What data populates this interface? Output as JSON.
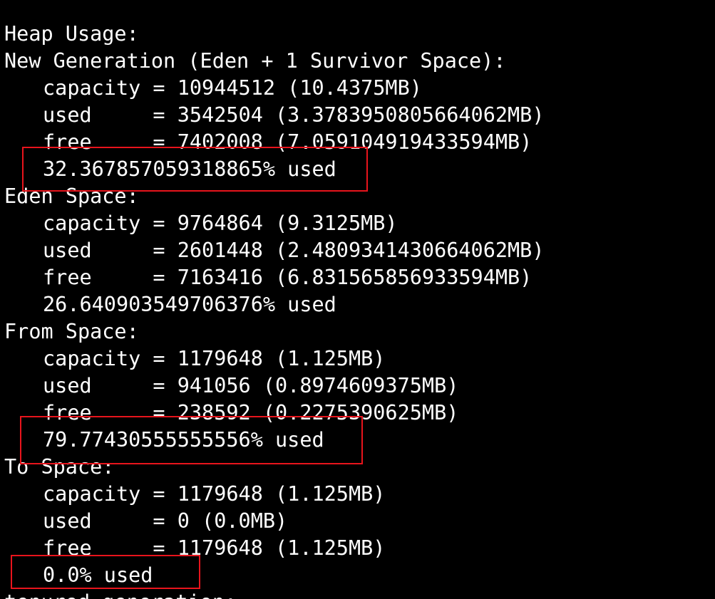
{
  "terminal": {
    "lines": [
      "Heap Usage:",
      "New Generation (Eden + 1 Survivor Space):",
      "capacity = 10944512 (10.4375MB)",
      "used     = 3542504 (3.3783950805664062MB)",
      "free     = 7402008 (7.059104919433594MB)",
      "32.367857059318865% used",
      "Eden Space:",
      "capacity = 9764864 (9.3125MB)",
      "used     = 2601448 (2.4809341430664062MB)",
      "free     = 7163416 (6.831565856933594MB)",
      "26.640903549706376% used",
      "From Space:",
      "capacity = 1179648 (1.125MB)",
      "used     = 941056 (0.8974609375MB)",
      "free     = 238592 (0.2275390625MB)",
      "79.77430555555556% used",
      "To Space:",
      "capacity = 1179648 (1.125MB)",
      "used     = 0 (0.0MB)",
      "free     = 1179648 (1.125MB)",
      "0.0% used",
      "tenured generation:"
    ]
  },
  "colors": {
    "background": "#000000",
    "text": "#ffffff",
    "highlight": "#e8141c"
  }
}
